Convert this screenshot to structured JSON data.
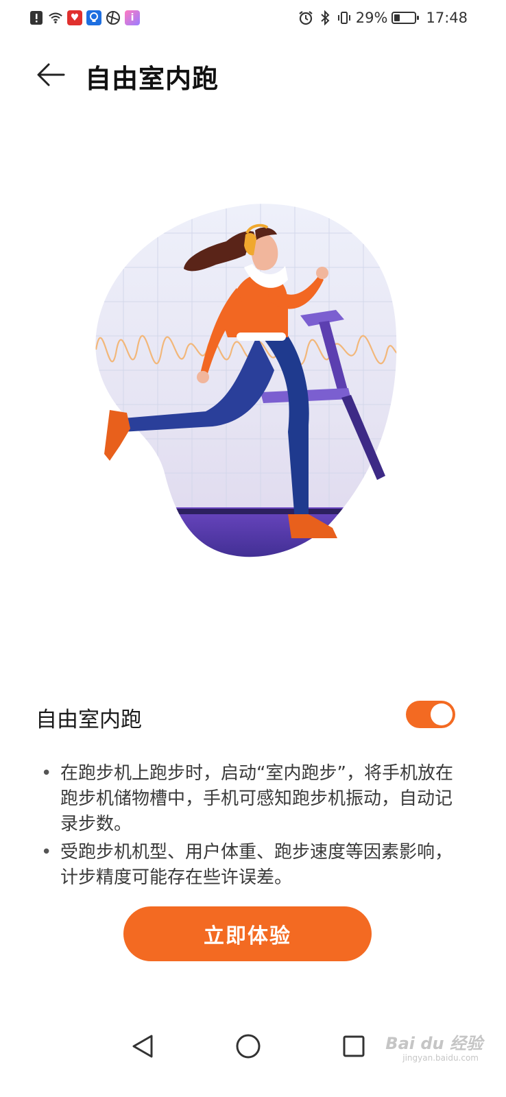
{
  "status_bar": {
    "left_icons": [
      "alert-icon",
      "wifi-icon",
      "app-icon-heart",
      "app-icon-bulb",
      "app-icon-sphere",
      "app-icon-info"
    ],
    "right_icons": [
      "alarm-icon",
      "bluetooth-icon",
      "vibrate-icon"
    ],
    "battery_text": "29%",
    "battery_level": 0.29,
    "time": "17:48"
  },
  "header": {
    "title": "自由室内跑"
  },
  "feature": {
    "label": "自由室内跑",
    "toggle_on": true
  },
  "description": [
    "在跑步机上跑步时，启动“室内跑步”，将手机放在跑步机储物槽中，手机可感知跑步机振动，自动记录步数。",
    "受跑步机机型、用户体重、跑步速度等因素影响，计步精度可能存在些许误差。"
  ],
  "cta": {
    "label": "立即体验"
  },
  "nav_bar": {
    "items": [
      "back-nav-icon",
      "home-nav-icon",
      "recents-nav-icon"
    ]
  },
  "watermark": {
    "text": "Bai du 经验",
    "sub": "jingyan.baidu.com"
  },
  "colors": {
    "accent": "#F36A22"
  }
}
